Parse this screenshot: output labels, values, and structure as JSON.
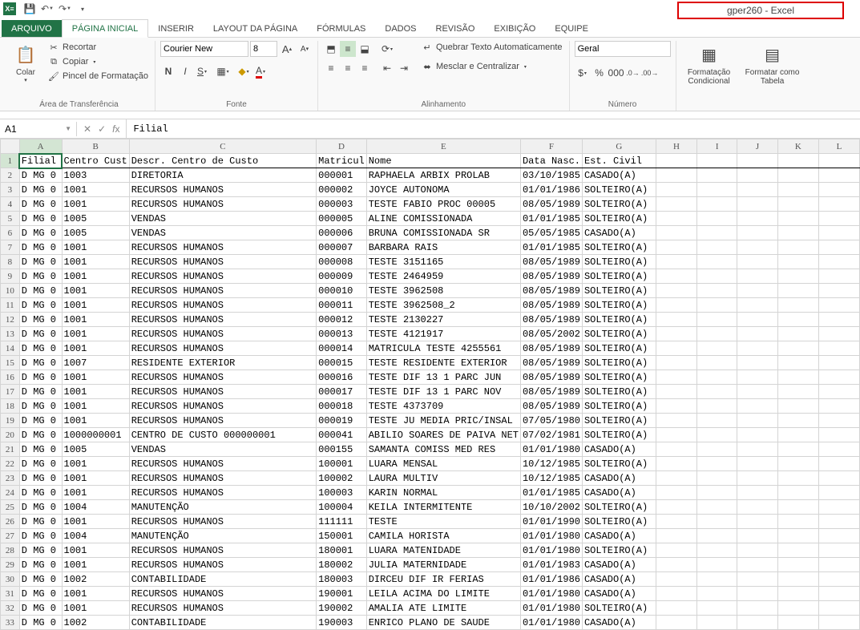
{
  "title": "gper260 - Excel",
  "qat": {
    "save": "💾",
    "undo": "↶",
    "redo": "↷"
  },
  "tabs": [
    "ARQUIVO",
    "PÁGINA INICIAL",
    "INSERIR",
    "LAYOUT DA PÁGINA",
    "FÓRMULAS",
    "DADOS",
    "REVISÃO",
    "EXIBIÇÃO",
    "EQUIPE"
  ],
  "ribbon": {
    "clipboard": {
      "paste": "Colar",
      "cut": "Recortar",
      "copy": "Copiar",
      "brush": "Pincel de Formatação",
      "label": "Área de Transferência"
    },
    "font": {
      "name": "Courier New",
      "size": "8",
      "label": "Fonte"
    },
    "align": {
      "wrap": "Quebrar Texto Automaticamente",
      "merge": "Mesclar e Centralizar",
      "label": "Alinhamento"
    },
    "number": {
      "format": "Geral",
      "label": "Número"
    },
    "styles": {
      "cond": "Formatação Condicional",
      "table": "Formatar como Tabela"
    }
  },
  "cell_ref": "A1",
  "cell_val": "Filial",
  "columns": [
    "A",
    "B",
    "C",
    "D",
    "E",
    "F",
    "G",
    "H",
    "I",
    "J",
    "K",
    "L"
  ],
  "headers": {
    "A": "Filial",
    "B": "Centro Cust",
    "C": "Descr. Centro de Custo",
    "D": "Matricul",
    "E": "Nome",
    "F": "Data Nasc.",
    "G": "Est. Civil"
  },
  "rows": [
    {
      "n": 2,
      "A": "D MG 0",
      "B": "1003",
      "C": "DIRETORIA",
      "D": "000001",
      "E": "RAPHAELA ARBIX PROLAB",
      "F": "03/10/1985",
      "G": "CASADO(A)"
    },
    {
      "n": 3,
      "A": "D MG 0",
      "B": "1001",
      "C": "RECURSOS HUMANOS",
      "D": "000002",
      "E": "JOYCE AUTONOMA",
      "F": "01/01/1986",
      "G": "SOLTEIRO(A)"
    },
    {
      "n": 4,
      "A": "D MG 0",
      "B": "1001",
      "C": "RECURSOS HUMANOS",
      "D": "000003",
      "E": "TESTE FABIO PROC 00005",
      "F": "08/05/1989",
      "G": "SOLTEIRO(A)"
    },
    {
      "n": 5,
      "A": "D MG 0",
      "B": "1005",
      "C": "VENDAS",
      "D": "000005",
      "E": "ALINE COMISSIONADA",
      "F": "01/01/1985",
      "G": "SOLTEIRO(A)"
    },
    {
      "n": 6,
      "A": "D MG 0",
      "B": "1005",
      "C": "VENDAS",
      "D": "000006",
      "E": "BRUNA COMISSIONADA SR",
      "F": "05/05/1985",
      "G": "CASADO(A)"
    },
    {
      "n": 7,
      "A": "D MG 0",
      "B": "1001",
      "C": "RECURSOS HUMANOS",
      "D": "000007",
      "E": "BARBARA RAIS",
      "F": "01/01/1985",
      "G": "SOLTEIRO(A)"
    },
    {
      "n": 8,
      "A": "D MG 0",
      "B": "1001",
      "C": "RECURSOS HUMANOS",
      "D": "000008",
      "E": "TESTE 3151165",
      "F": "08/05/1989",
      "G": "SOLTEIRO(A)"
    },
    {
      "n": 9,
      "A": "D MG 0",
      "B": "1001",
      "C": "RECURSOS HUMANOS",
      "D": "000009",
      "E": "TESTE 2464959",
      "F": "08/05/1989",
      "G": "SOLTEIRO(A)"
    },
    {
      "n": 10,
      "A": "D MG 0",
      "B": "1001",
      "C": "RECURSOS HUMANOS",
      "D": "000010",
      "E": "TESTE 3962508",
      "F": "08/05/1989",
      "G": "SOLTEIRO(A)"
    },
    {
      "n": 11,
      "A": "D MG 0",
      "B": "1001",
      "C": "RECURSOS HUMANOS",
      "D": "000011",
      "E": "TESTE  3962508_2",
      "F": "08/05/1989",
      "G": "SOLTEIRO(A)"
    },
    {
      "n": 12,
      "A": "D MG 0",
      "B": "1001",
      "C": "RECURSOS HUMANOS",
      "D": "000012",
      "E": "TESTE 2130227",
      "F": "08/05/1989",
      "G": "SOLTEIRO(A)"
    },
    {
      "n": 13,
      "A": "D MG 0",
      "B": "1001",
      "C": "RECURSOS HUMANOS",
      "D": "000013",
      "E": "TESTE 4121917",
      "F": "08/05/2002",
      "G": "SOLTEIRO(A)"
    },
    {
      "n": 14,
      "A": "D MG 0",
      "B": "1001",
      "C": "RECURSOS HUMANOS",
      "D": "000014",
      "E": "MATRICULA TESTE 4255561",
      "F": "08/05/1989",
      "G": "SOLTEIRO(A)"
    },
    {
      "n": 15,
      "A": "D MG 0",
      "B": "1007",
      "C": "RESIDENTE EXTERIOR",
      "D": "000015",
      "E": "TESTE RESIDENTE EXTERIOR",
      "F": "08/05/1989",
      "G": "SOLTEIRO(A)"
    },
    {
      "n": 16,
      "A": "D MG 0",
      "B": "1001",
      "C": "RECURSOS HUMANOS",
      "D": "000016",
      "E": "TESTE DIF 13 1 PARC JUN",
      "F": "08/05/1989",
      "G": "SOLTEIRO(A)"
    },
    {
      "n": 17,
      "A": "D MG 0",
      "B": "1001",
      "C": "RECURSOS HUMANOS",
      "D": "000017",
      "E": "TESTE DIF 13 1 PARC NOV",
      "F": "08/05/1989",
      "G": "SOLTEIRO(A)"
    },
    {
      "n": 18,
      "A": "D MG 0",
      "B": "1001",
      "C": "RECURSOS HUMANOS",
      "D": "000018",
      "E": "TESTE 4373709",
      "F": "08/05/1989",
      "G": "SOLTEIRO(A)"
    },
    {
      "n": 19,
      "A": "D MG 0",
      "B": "1001",
      "C": "RECURSOS HUMANOS",
      "D": "000019",
      "E": "TESTE JU MEDIA PRIC/INSAL",
      "F": "07/05/1980",
      "G": "SOLTEIRO(A)"
    },
    {
      "n": 20,
      "A": "D MG 0",
      "B": "1000000001",
      "C": "CENTRO DE CUSTO 000000001",
      "D": "000041",
      "E": "ABILIO SOARES DE PAIVA NET",
      "F": "07/02/1981",
      "G": "SOLTEIRO(A)"
    },
    {
      "n": 21,
      "A": "D MG 0",
      "B": "1005",
      "C": "VENDAS",
      "D": "000155",
      "E": "SAMANTA COMISS MED RES",
      "F": "01/01/1980",
      "G": "CASADO(A)"
    },
    {
      "n": 22,
      "A": "D MG 0",
      "B": "1001",
      "C": "RECURSOS HUMANOS",
      "D": "100001",
      "E": "LUARA MENSAL",
      "F": "10/12/1985",
      "G": "SOLTEIRO(A)"
    },
    {
      "n": 23,
      "A": "D MG 0",
      "B": "1001",
      "C": "RECURSOS HUMANOS",
      "D": "100002",
      "E": "LAURA MULTIV",
      "F": "10/12/1985",
      "G": "CASADO(A)"
    },
    {
      "n": 24,
      "A": "D MG 0",
      "B": "1001",
      "C": "RECURSOS HUMANOS",
      "D": "100003",
      "E": "KARIN NORMAL",
      "F": "01/01/1985",
      "G": "CASADO(A)"
    },
    {
      "n": 25,
      "A": "D MG 0",
      "B": "1004",
      "C": "MANUTENÇÃO",
      "D": "100004",
      "E": "KEILA INTERMITENTE",
      "F": "10/10/2002",
      "G": "SOLTEIRO(A)"
    },
    {
      "n": 26,
      "A": "D MG 0",
      "B": "1001",
      "C": "RECURSOS HUMANOS",
      "D": "111111",
      "E": "TESTE",
      "F": "01/01/1990",
      "G": "SOLTEIRO(A)"
    },
    {
      "n": 27,
      "A": "D MG 0",
      "B": "1004",
      "C": "MANUTENÇÃO",
      "D": "150001",
      "E": "CAMILA HORISTA",
      "F": "01/01/1980",
      "G": "CASADO(A)"
    },
    {
      "n": 28,
      "A": "D MG 0",
      "B": "1001",
      "C": "RECURSOS HUMANOS",
      "D": "180001",
      "E": "LUARA MATENIDADE",
      "F": "01/01/1980",
      "G": "SOLTEIRO(A)"
    },
    {
      "n": 29,
      "A": "D MG 0",
      "B": "1001",
      "C": "RECURSOS HUMANOS",
      "D": "180002",
      "E": "JULIA MATERNIDADE",
      "F": "01/01/1983",
      "G": "CASADO(A)"
    },
    {
      "n": 30,
      "A": "D MG 0",
      "B": "1002",
      "C": "CONTABILIDADE",
      "D": "180003",
      "E": "DIRCEU DIF IR FERIAS",
      "F": "01/01/1986",
      "G": "CASADO(A)"
    },
    {
      "n": 31,
      "A": "D MG 0",
      "B": "1001",
      "C": "RECURSOS HUMANOS",
      "D": "190001",
      "E": "LEILA ACIMA DO LIMITE",
      "F": "01/01/1980",
      "G": "CASADO(A)"
    },
    {
      "n": 32,
      "A": "D MG 0",
      "B": "1001",
      "C": "RECURSOS HUMANOS",
      "D": "190002",
      "E": "AMALIA ATE LIMITE",
      "F": "01/01/1980",
      "G": "SOLTEIRO(A)"
    },
    {
      "n": 33,
      "A": "D MG 0",
      "B": "1002",
      "C": "CONTABILIDADE",
      "D": "190003",
      "E": "ENRICO PLANO DE SAUDE",
      "F": "01/01/1980",
      "G": "CASADO(A)"
    }
  ]
}
